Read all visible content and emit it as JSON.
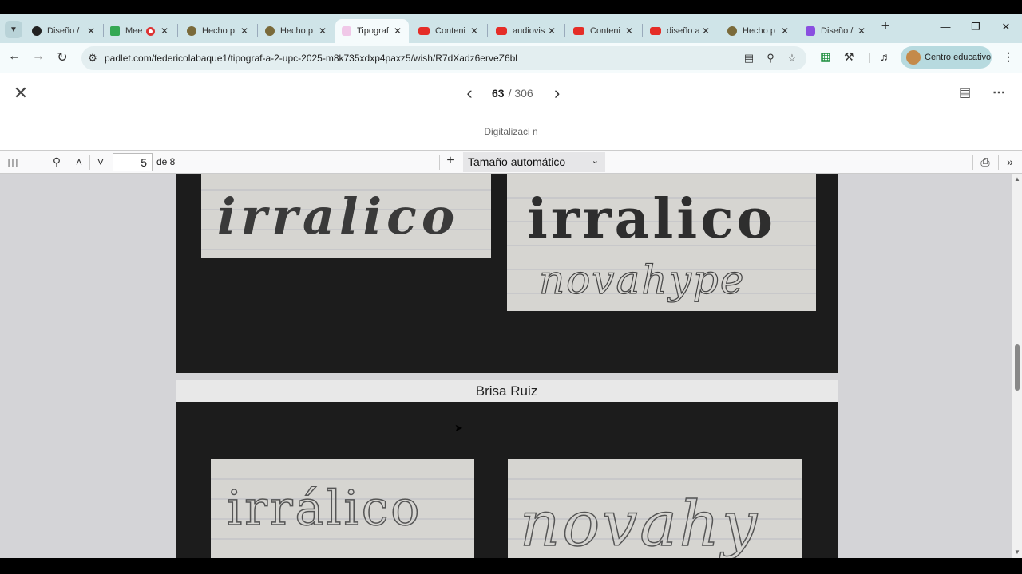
{
  "tabs": [
    {
      "label": "Diseño /",
      "favicon": "github-icon",
      "color": "#222222"
    },
    {
      "label": "Mee",
      "favicon": "meet-icon",
      "color": "#34a853",
      "recording": true
    },
    {
      "label": "Hecho p",
      "favicon": "figure-icon",
      "color": "#7a6a3a"
    },
    {
      "label": "Hecho p",
      "favicon": "figure-icon",
      "color": "#7a6a3a"
    },
    {
      "label": "Tipograf",
      "favicon": "padlet-icon",
      "color": "#f0c8e8",
      "active": true
    },
    {
      "label": "Conteni",
      "favicon": "youtube-icon",
      "color": "#e52d27"
    },
    {
      "label": "audiovis",
      "favicon": "youtube-icon",
      "color": "#e52d27"
    },
    {
      "label": "Conteni",
      "favicon": "youtube-icon",
      "color": "#e52d27"
    },
    {
      "label": "diseño a",
      "favicon": "youtube-icon",
      "color": "#e52d27"
    },
    {
      "label": "Hecho p",
      "favicon": "figure-icon",
      "color": "#7a6a3a"
    },
    {
      "label": "Diseño /",
      "favicon": "canva-icon",
      "color": "#8a4fe0"
    }
  ],
  "address": {
    "url": "padlet.com/federicolabaque1/tipograf-a-2-upc-2025-m8k735xdxp4paxz5/wish/R7dXadz6erveZ6bl",
    "profile_label": "Centro educativo"
  },
  "padlet": {
    "current": "63",
    "separator": "/",
    "total": "306",
    "subtitle": "Digitalizaci n"
  },
  "pdf": {
    "page_value": "5",
    "of_label": "de 8",
    "zoom_label": "Tamaño automático"
  },
  "document": {
    "author_name": "Brisa Ruiz",
    "word_top_left": "irralico",
    "word_top_right": "irralico",
    "word_top_right_2": "novahype",
    "word_bottom_left": "irrálico",
    "word_bottom_right": "novahy"
  }
}
